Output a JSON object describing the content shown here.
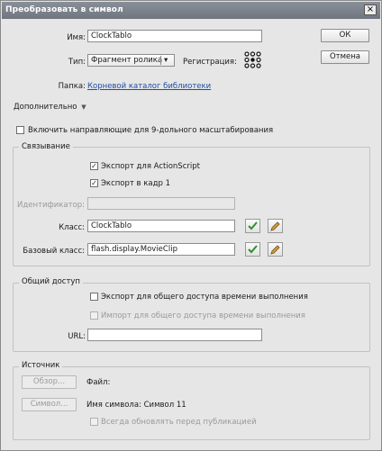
{
  "window": {
    "title": "Преобразовать в символ",
    "close": "×"
  },
  "name": {
    "label": "Имя:",
    "value": "ClockTablo"
  },
  "type": {
    "label": "Тип:",
    "value": "Фрагмент ролика",
    "arrow": "▾"
  },
  "registration": {
    "label": "Регистрация:"
  },
  "folder": {
    "label": "Папка:",
    "value": "Корневой каталог библиотеки"
  },
  "buttons": {
    "ok": "ОК",
    "cancel": "Отмена"
  },
  "advanced": {
    "label": "Дополнительно",
    "arrow": "▼"
  },
  "scale9": {
    "label": "Включить направляющие для 9-дольного масштабирования",
    "checked": false
  },
  "linkage": {
    "title": "Связывание",
    "export_as": {
      "label": "Экспорт для ActionScript",
      "checked": true
    },
    "export_frame": {
      "label": "Экспорт в кадр 1",
      "checked": true
    },
    "identifier": {
      "label": "Идентификатор:",
      "value": ""
    },
    "class": {
      "label": "Класс:",
      "value": "ClockTablo"
    },
    "base_class": {
      "label": "Базовый класс:",
      "value": "flash.display.MovieClip"
    }
  },
  "sharing": {
    "title": "Общий доступ",
    "export_runtime": {
      "label": "Экспорт для общего доступа времени выполнения",
      "checked": false
    },
    "import_runtime": {
      "label": "Импорт для общего доступа времени выполнения",
      "checked": false
    },
    "url": {
      "label": "URL:",
      "value": ""
    }
  },
  "source": {
    "title": "Источник",
    "browse": "Обзор...",
    "file_label": "Файл:",
    "symbol_btn": "Символ...",
    "symbol_name": "Имя символа: Символ 11",
    "auto_update": {
      "label": "Всегда обновлять перед публикацией",
      "checked": false
    }
  },
  "icons": {
    "check": "check-icon",
    "edit": "pencil-icon",
    "registration": "registration-grid-icon"
  },
  "colors": {
    "accent_link": "#1c4fa8",
    "check_green": "#2f8f2f"
  }
}
